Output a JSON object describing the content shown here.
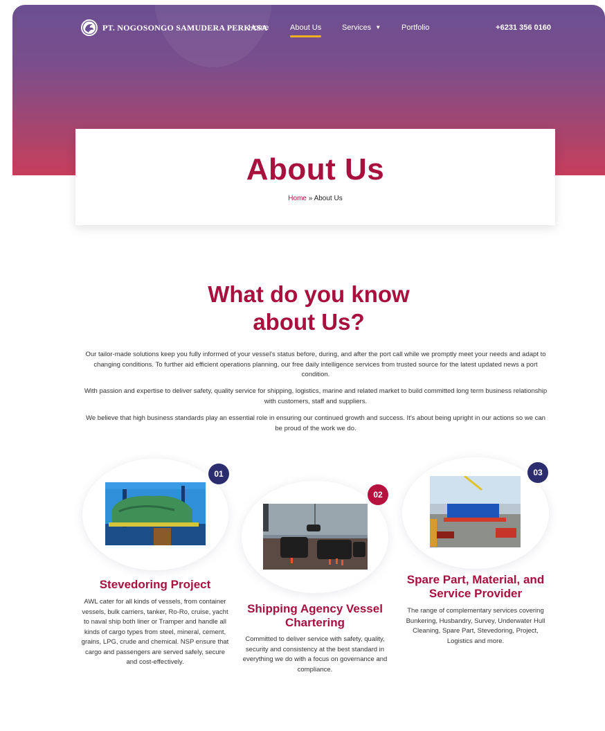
{
  "header": {
    "brand": "PT. NOGOSONGO SAMUDERA PERKASA",
    "nav": [
      {
        "label": "Home"
      },
      {
        "label": "About Us"
      },
      {
        "label": "Services"
      },
      {
        "label": "Portfolio"
      }
    ],
    "phone": "+6231 356 0160"
  },
  "title_card": {
    "title": "About Us",
    "breadcrumb_home": "Home",
    "breadcrumb_sep": "»",
    "breadcrumb_current": "About Us"
  },
  "about": {
    "heading_line1": "What do you know",
    "heading_line2": "about Us?",
    "paragraphs": [
      "Our tailor-made solutions keep you fully informed of your vessel's status before, during, and after the port call while we promptly meet your needs and adapt to changing conditions. To further aid efficient operations planning, our free daily intelligence services from trusted source for the latest updated news a port condition.",
      "With passion and expertise to deliver safety, quality service for shipping, logistics, marine and related market to build committed long term business relationship with customers, staff and suppliers.",
      "We believe that high business standards play an essential role in ensuring our continued growth and success. It's about being upright in our actions so we can be proud of the work we do."
    ]
  },
  "services": [
    {
      "number": "01",
      "title": "Stevedoring Project",
      "text": "AWL cater for all kinds of vessels, from container vessels, bulk carriers, tanker, Ro-Ro, cruise, yacht to naval ship both liner or Tramper and handle all kinds of cargo types from steel, mineral, cement, grains, LPG, crude and chemical. NSP ensure that cargo and passengers are served safely, secure and cost-effectively."
    },
    {
      "number": "02",
      "title": "Shipping Agency Vessel Chartering",
      "text": "Committed to deliver service with safety, quality, security and consistency at the best standard in everything we do with a focus on governance and compliance."
    },
    {
      "number": "03",
      "title": "Spare Part, Material, and Service Provider",
      "text": "The range of complementary services covering Bunkering, Husbandry, Survey, Underwater Hull Cleaning, Spare Part, Stevedoring, Project, Logistics and more."
    }
  ],
  "colors": {
    "brand_red": "#a8103e",
    "accent_yellow": "#f2b01e",
    "badge_navy": "#2b2d6e",
    "badge_red": "#b5123f"
  },
  "icons": {
    "logo": "dragon-emblem-icon",
    "services_dropdown": "chevron-down-icon"
  }
}
